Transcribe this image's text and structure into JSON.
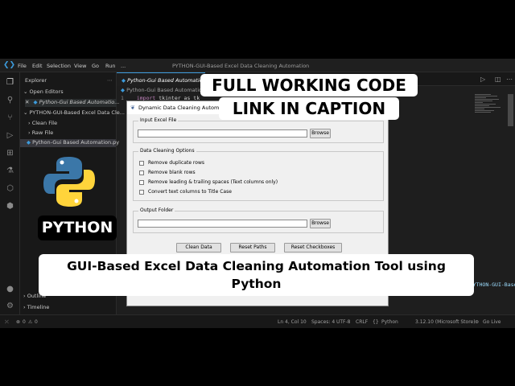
{
  "window": {
    "title": "PYTHON-GUI-Based Excel Data Cleaning Automation",
    "menus": [
      "File",
      "Edit",
      "Selection",
      "View",
      "Go",
      "Run",
      "..."
    ]
  },
  "sidebar": {
    "header": "Explorer",
    "open_editors_label": "Open Editors",
    "open_editor_file": "Python-Gui Based Automatio...",
    "project_label": "PYTHON-GUI-Based Excel Data Cle...",
    "items": [
      "Clean File",
      "Raw File",
      "Python-Gui Based Automation.py"
    ],
    "outline_label": "Outline",
    "timeline_label": "Timeline"
  },
  "editor": {
    "tab_label": "Python-Gui Based Automation.p",
    "breadcrumb": "Python-Gui Based Automation",
    "line_number": "1",
    "code_keyword": "import",
    "code_rest": "tkinter as tk"
  },
  "terminal": {
    "path_text": "d:\\Python\\PROJECTS Python\\PYTHON-GUI-Base"
  },
  "statusbar": {
    "errors": "0",
    "warnings": "0",
    "position": "Ln 4, Col 10",
    "spaces": "Spaces: 4",
    "encoding": "UTF-8",
    "eol": "CRLF",
    "language": "Python",
    "interpreter": "3.12.10 (Microsoft Store)",
    "go_live": "Go Live"
  },
  "dialog": {
    "title": "Dynamic Data Cleaning Automation",
    "input_group_label": "Input Excel File",
    "input_value": "",
    "browse_label": "Browse",
    "options_group_label": "Data Cleaning Options",
    "options": [
      "Remove duplicate rows",
      "Remove blank rows",
      "Remove leading & trailing spaces (Text columns only)",
      "Convert text columns to Title Case"
    ],
    "output_group_label": "Output Folder",
    "output_value": "",
    "output_browse_label": "Browse",
    "clean_button": "Clean Data",
    "reset_paths_button": "Reset Paths",
    "reset_checkboxes_button": "Reset Checkboxes"
  },
  "overlay": {
    "headline_line1": "FULL WORKING CODE",
    "headline_line2": "LINK IN CAPTION",
    "python_badge": "PYTHON",
    "caption_line1": "GUI-Based Excel Data Cleaning Automation Tool using",
    "caption_line2": "Python"
  },
  "colors": {
    "vscode_bg": "#1e1e1e",
    "accent": "#3c9bdc",
    "python_blue": "#3b77a8",
    "python_yellow": "#ffd43b"
  }
}
